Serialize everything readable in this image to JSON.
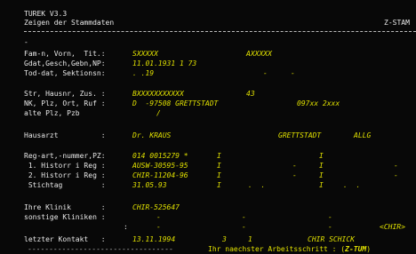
{
  "header": {
    "app": "TUREK V3.3",
    "title": "Zeigen der Stammdaten",
    "right": "Z-STAM"
  },
  "separator_marker": "-",
  "person": {
    "name_label": "Fam-n, Vorn,  Tit.:",
    "name_val1": "SXXXXX",
    "name_val2": "AXXXXX",
    "gdat_label": "Gdat,Gesch,Gebn,NP:",
    "gdat_val": "11.01.1931 1 73",
    "tod_label": "Tod-dat, Sektionsn:",
    "tod_val": ". .19",
    "tod_dash1": "-",
    "tod_dash2": "-"
  },
  "address": {
    "str_label": "Str, Hausnr, Zus. :",
    "str_val": "BXXXXXXXXXXX",
    "str_nr": "43",
    "nk_label": "NK, Plz, Ort, Ruf :",
    "nk_val": "D  -97508 GRETTSTADT",
    "nk_phone": "097xx 2xxx",
    "alt_label": "alte Plz, Pzb",
    "alt_val": "/"
  },
  "doctor": {
    "label": "Hausarzt          :",
    "name": "Dr. KRAUS",
    "city": "GRETTSTADT",
    "type": "ALLG"
  },
  "registry": {
    "reg_label": "Reg-art,-nummer,PZ:",
    "reg_val": "014 0015279 *",
    "reg_i1": "I",
    "reg_i2": "I",
    "h1_label": " 1. Historr i Reg :",
    "h1_val": "AUSW-30595-95",
    "h1_i1": "I",
    "h1_d1": "-",
    "h1_i2": "I",
    "h1_d2": "-",
    "h2_label": " 2. Historr i Reg :",
    "h2_val": "CHIR-11204-96",
    "h2_i1": "I",
    "h2_d1": "-",
    "h2_i2": "I",
    "h2_d2": "-",
    "st_label": " Stichtag         :",
    "st_val": "31.05.93",
    "st_i1": "I",
    "st_dots1": ".  .",
    "st_i2": "I",
    "st_dots2": ".  ."
  },
  "clinic": {
    "label": "Ihre Klinik       :",
    "val": "CHIR-525647",
    "other_label": "sonstige Kliniken :",
    "o1_a": "-",
    "o1_b": "-",
    "o1_c": "-",
    "o2_colon": ":",
    "o2_a": "-",
    "o2_b": "-",
    "o2_c": "-",
    "chir_tag": "<CHIR>"
  },
  "contact": {
    "label": "letzter Kontakt   :",
    "date": "13.11.1994",
    "n1": "3",
    "n2": "1",
    "who": "CHIR SCHICK"
  },
  "footer": {
    "dashes": "----------------------------------",
    "prompt": "Ihr naechster Arbeitsschritt : (",
    "step": "Z-TUM",
    "close": ")"
  }
}
